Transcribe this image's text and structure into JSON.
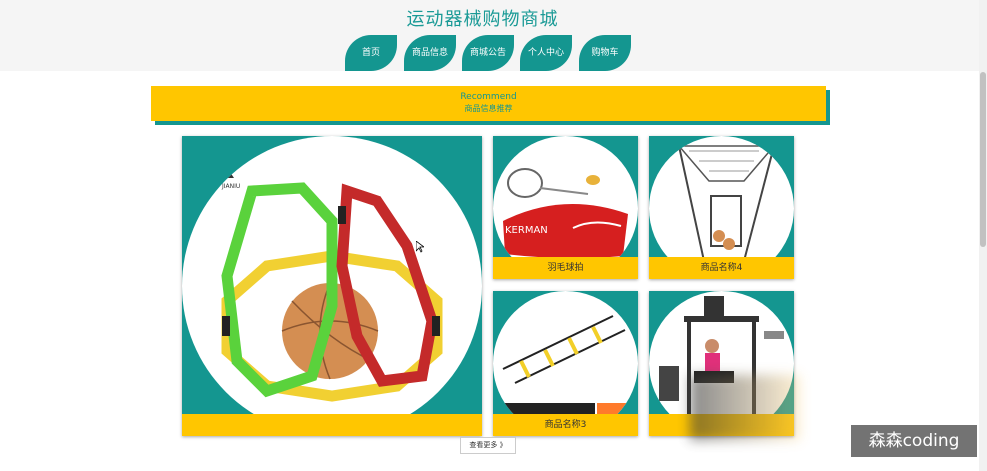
{
  "site": {
    "title": "运动器械购物商城"
  },
  "nav": [
    {
      "label": "首页"
    },
    {
      "label": "商品信息"
    },
    {
      "label": "商城公告"
    },
    {
      "label": "个人中心"
    },
    {
      "label": "购物车"
    }
  ],
  "recommend": {
    "title_en": "Recommend",
    "title_cn": "商品信息推荐"
  },
  "products": [
    {
      "name": ""
    },
    {
      "name": "羽毛球拍",
      "brand_text": "KERMAN"
    },
    {
      "name": "商品名称4"
    },
    {
      "name": "商品名称3"
    },
    {
      "name": ""
    }
  ],
  "more_button": "查看更多 》",
  "watermark": "森森coding",
  "colors": {
    "teal": "#149690",
    "yellow": "#ffc600",
    "title": "#1a9a96"
  }
}
